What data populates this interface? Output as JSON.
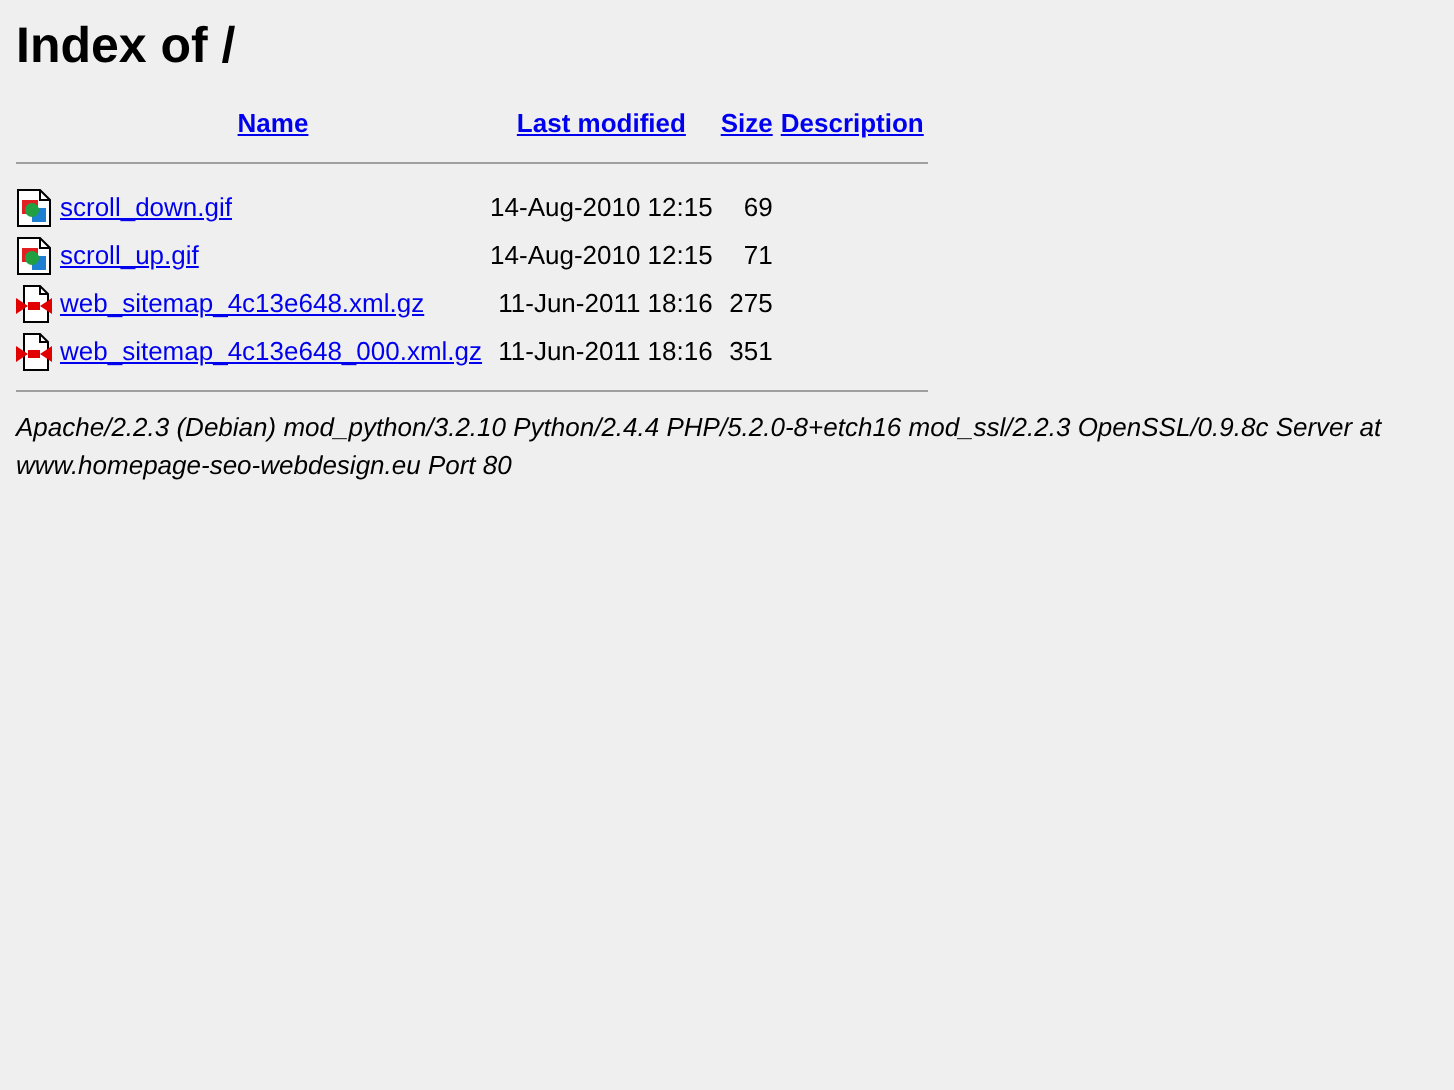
{
  "title": "Index of /",
  "columns": [
    "Name",
    "Last modified",
    "Size",
    "Description"
  ],
  "rows": [
    {
      "kind": "image",
      "name": "scroll_down.gif",
      "modified": "14-Aug-2010 12:15",
      "size": "69"
    },
    {
      "kind": "image",
      "name": "scroll_up.gif",
      "modified": "14-Aug-2010 12:15",
      "size": "71"
    },
    {
      "kind": "archive",
      "name": "web_sitemap_4c13e648.xml.gz",
      "modified": "11-Jun-2011 18:16",
      "size": "275"
    },
    {
      "kind": "archive",
      "name": "web_sitemap_4c13e648_000.xml.gz",
      "modified": "11-Jun-2011 18:16",
      "size": "351"
    }
  ],
  "address": "Apache/2.2.3 (Debian) mod_python/3.2.10 Python/2.4.4 PHP/5.2.0-8+etch16 mod_ssl/2.2.3 OpenSSL/0.9.8c Server at www.homepage-seo-webdesign.eu Port 80"
}
